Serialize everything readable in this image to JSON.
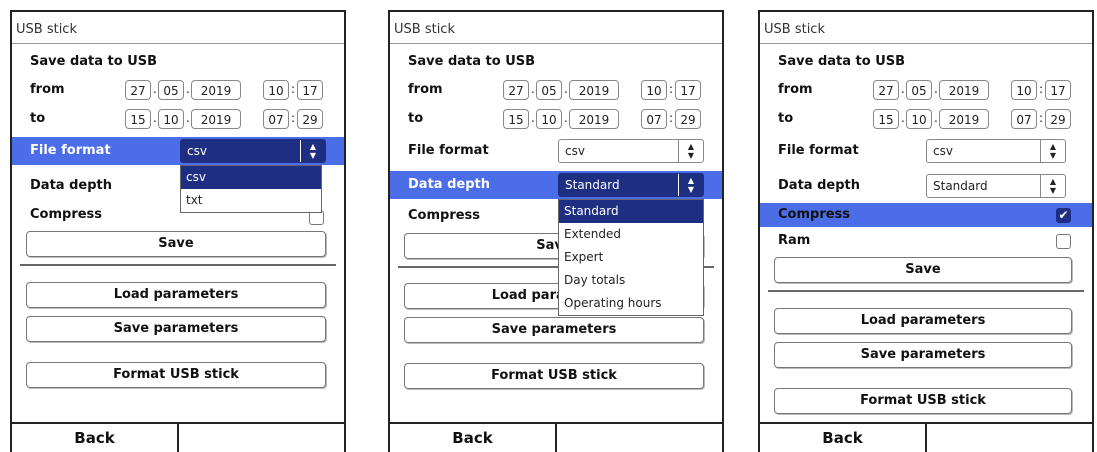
{
  "colors": {
    "highlight": "#4c6de8",
    "selected": "#1e2e82"
  },
  "icons": {
    "select_arrows": "updown-arrows-icon",
    "checkmark": "checkmark-icon"
  },
  "panels": [
    {
      "title": "USB stick",
      "heading": "Save data to USB",
      "from": {
        "label": "from",
        "day": "27",
        "month": "05",
        "year": "2019",
        "hour": "10",
        "minute": "17"
      },
      "to": {
        "label": "to",
        "day": "15",
        "month": "10",
        "year": "2019",
        "hour": "07",
        "minute": "29"
      },
      "file_format": {
        "label": "File format",
        "value": "csv"
      },
      "data_depth": {
        "label": "Data depth"
      },
      "compress": {
        "label": "Compress"
      },
      "dropdown": [
        "csv",
        "txt"
      ],
      "buttons": {
        "save": "Save",
        "load": "Load parameters",
        "save_params": "Save parameters",
        "format": "Format USB stick"
      },
      "footer": {
        "back": "Back"
      }
    },
    {
      "title": "USB stick",
      "heading": "Save data to USB",
      "from": {
        "label": "from",
        "day": "27",
        "month": "05",
        "year": "2019",
        "hour": "10",
        "minute": "17"
      },
      "to": {
        "label": "to",
        "day": "15",
        "month": "10",
        "year": "2019",
        "hour": "07",
        "minute": "29"
      },
      "file_format": {
        "label": "File format",
        "value": "csv"
      },
      "data_depth": {
        "label": "Data depth",
        "value": "Standard"
      },
      "compress": {
        "label": "Compress"
      },
      "dropdown": [
        "Standard",
        "Extended",
        "Expert",
        "Day totals",
        "Operating hours"
      ],
      "buttons": {
        "save": "Save",
        "load": "Load parameters",
        "save_params": "Save parameters",
        "format": "Format USB stick"
      },
      "footer": {
        "back": "Back"
      }
    },
    {
      "title": "USB stick",
      "heading": "Save data to USB",
      "from": {
        "label": "from",
        "day": "27",
        "month": "05",
        "year": "2019",
        "hour": "10",
        "minute": "17"
      },
      "to": {
        "label": "to",
        "day": "15",
        "month": "10",
        "year": "2019",
        "hour": "07",
        "minute": "29"
      },
      "file_format": {
        "label": "File format",
        "value": "csv"
      },
      "data_depth": {
        "label": "Data depth",
        "value": "Standard"
      },
      "compress": {
        "label": "Compress",
        "checked": true
      },
      "ram": {
        "label": "Ram",
        "checked": false
      },
      "buttons": {
        "save": "Save",
        "load": "Load parameters",
        "save_params": "Save parameters",
        "format": "Format USB stick"
      },
      "footer": {
        "back": "Back"
      }
    }
  ]
}
